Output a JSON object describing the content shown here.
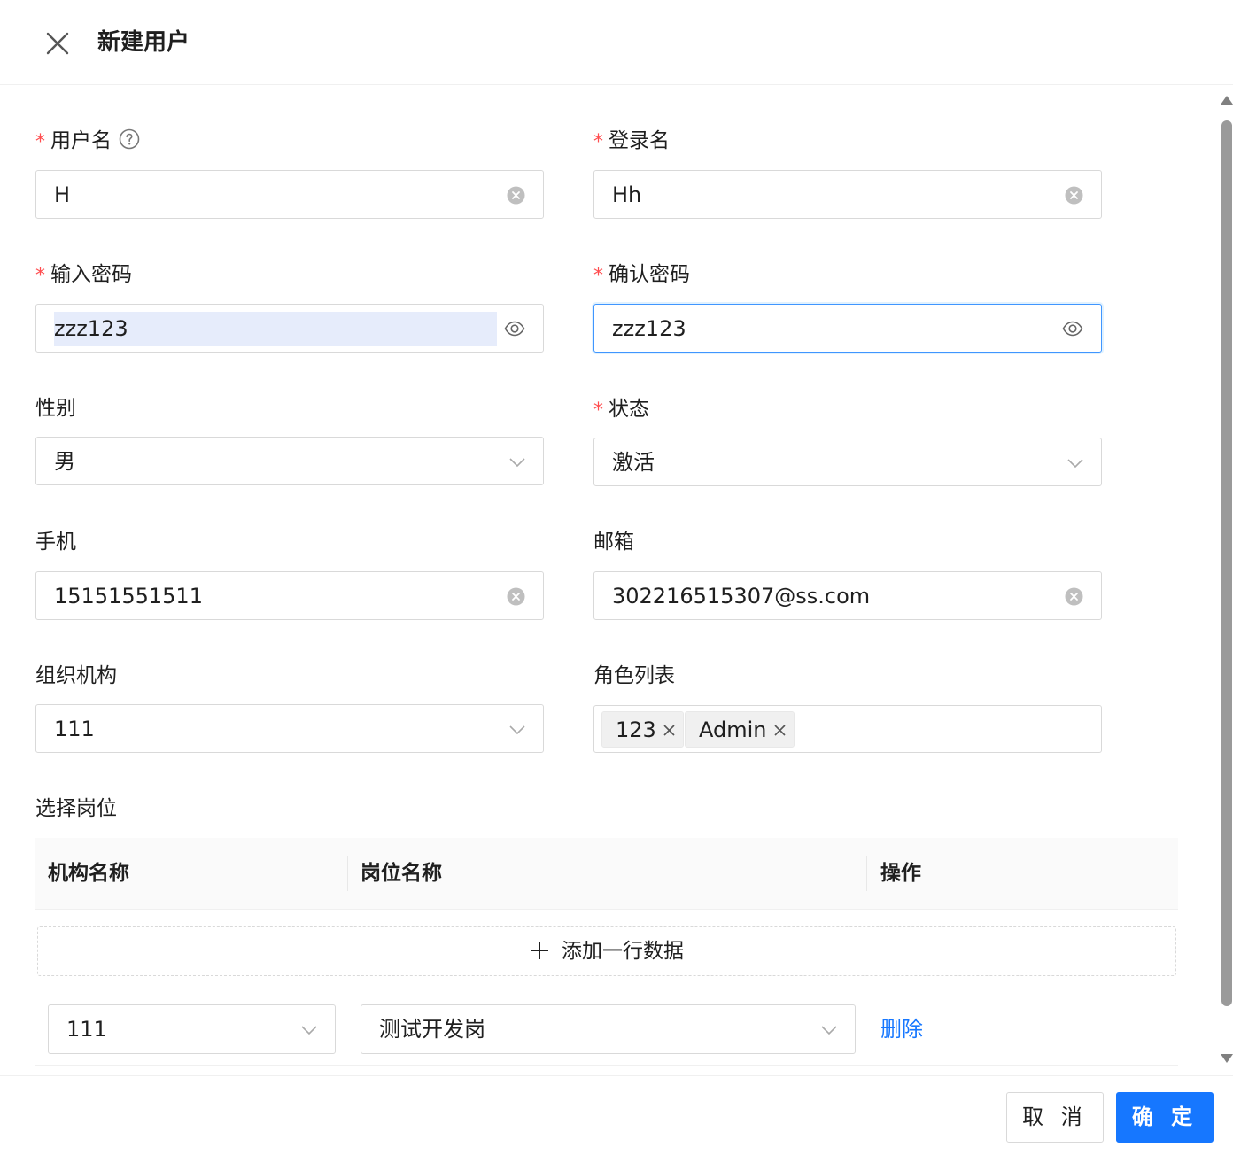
{
  "header": {
    "title": "新建用户"
  },
  "form": {
    "username": {
      "label": "用户名",
      "value": "H"
    },
    "login_name": {
      "label": "登录名",
      "value": "Hh"
    },
    "password": {
      "label": "输入密码",
      "value": "zzz123"
    },
    "confirm_password": {
      "label": "确认密码",
      "value": "zzz123"
    },
    "gender": {
      "label": "性别",
      "value": "男"
    },
    "status": {
      "label": "状态",
      "value": "激活"
    },
    "phone": {
      "label": "手机",
      "value": "15151551511"
    },
    "email": {
      "label": "邮箱",
      "value": "302216515307@ss.com"
    },
    "org": {
      "label": "组织机构",
      "value": "111"
    },
    "roles": {
      "label": "角色列表",
      "tags": [
        "123",
        "Admin"
      ]
    },
    "required_mark": "*"
  },
  "positions": {
    "section_label": "选择岗位",
    "columns": [
      "机构名称",
      "岗位名称",
      "操作"
    ],
    "add_row_label": "添加一行数据",
    "rows": [
      {
        "org": "111",
        "position": "测试开发岗",
        "action": "删除"
      }
    ]
  },
  "footer": {
    "cancel_label": "取 消",
    "ok_label": "确 定"
  },
  "colors": {
    "primary": "#1677ff",
    "required": "#ff4d4f",
    "border": "#d9d9d9",
    "selection": "#e6ecfb"
  }
}
